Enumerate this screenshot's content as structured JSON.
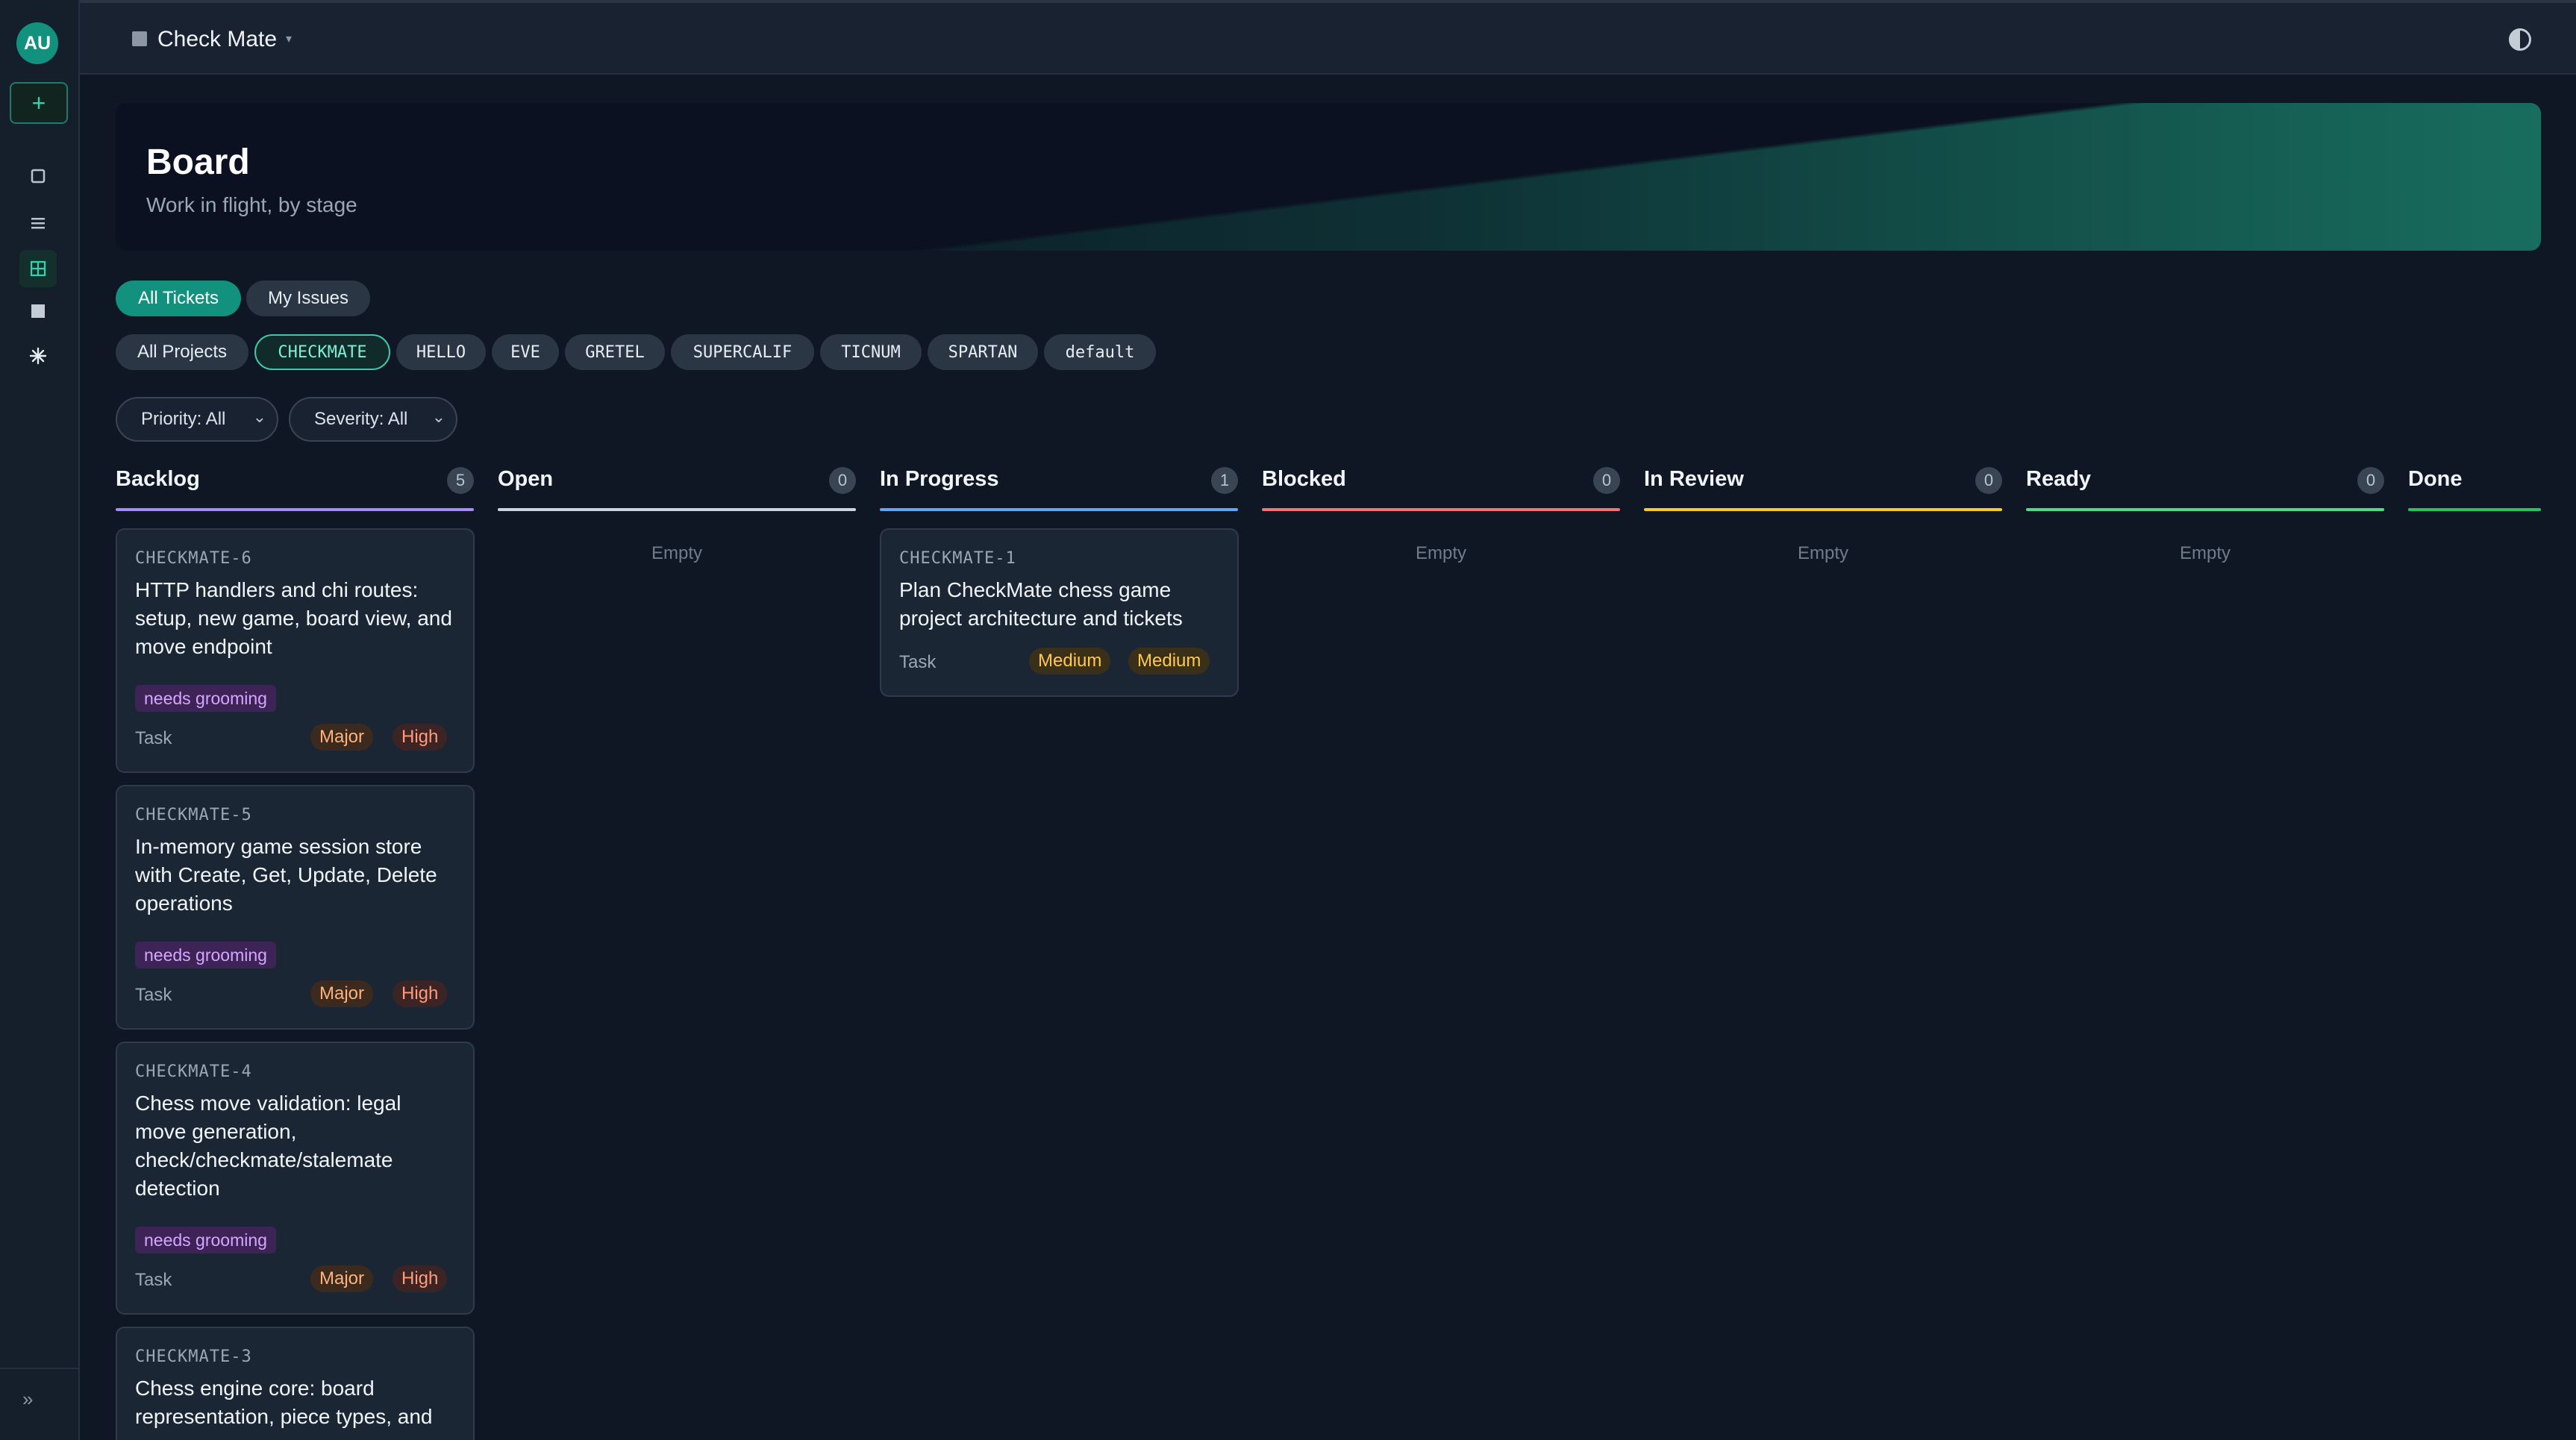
{
  "user": {
    "initials": "AU"
  },
  "sidebar": {
    "new_label": "+",
    "expand_label": "»"
  },
  "topbar": {
    "project_name": "Check Mate",
    "caret": "▾"
  },
  "banner": {
    "title": "Board",
    "subtitle": "Work in flight, by stage"
  },
  "view_tabs": [
    {
      "label": "All Tickets",
      "active": true
    },
    {
      "label": "My Issues",
      "active": false
    }
  ],
  "projects": [
    {
      "label": "All Projects"
    },
    {
      "label": "CHECKMATE",
      "selected": true
    },
    {
      "label": "HELLO"
    },
    {
      "label": "EVE"
    },
    {
      "label": "GRETEL"
    },
    {
      "label": "SUPERCALIF"
    },
    {
      "label": "TICNUM"
    },
    {
      "label": "SPARTAN"
    },
    {
      "label": "default"
    }
  ],
  "filters": {
    "priority": {
      "label": "Priority: All"
    },
    "severity": {
      "label": "Severity: All"
    }
  },
  "columns": [
    {
      "title": "Backlog",
      "count": "5",
      "color": "#a78bfa"
    },
    {
      "title": "Open",
      "count": "0",
      "color": "#cbd5e1",
      "empty": "Empty"
    },
    {
      "title": "In Progress",
      "count": "1",
      "color": "#60a5fa"
    },
    {
      "title": "Blocked",
      "count": "0",
      "color": "#f87171",
      "empty": "Empty"
    },
    {
      "title": "In Review",
      "count": "0",
      "color": "#facc15",
      "empty": "Empty"
    },
    {
      "title": "Ready",
      "count": "0",
      "color": "#4ade80",
      "empty": "Empty"
    },
    {
      "title": "Done",
      "color": "#22c55e"
    }
  ],
  "cards": {
    "backlog": [
      {
        "id": "CHECKMATE-6",
        "title": "HTTP handlers and chi routes: setup, new game, board view, and move endpoint",
        "tag": "needs grooming",
        "type": "Task",
        "severity": "Major",
        "priority": "High"
      },
      {
        "id": "CHECKMATE-5",
        "title": "In-memory game session store with Create, Get, Update, Delete operations",
        "tag": "needs grooming",
        "type": "Task",
        "severity": "Major",
        "priority": "High"
      },
      {
        "id": "CHECKMATE-4",
        "title": "Chess move validation: legal move generation, check/checkmate/stalemate detection",
        "tag": "needs grooming",
        "type": "Task",
        "severity": "Major",
        "priority": "High"
      },
      {
        "id": "CHECKMATE-3",
        "title": "Chess engine core: board representation, piece types, and"
      }
    ],
    "in_progress": [
      {
        "id": "CHECKMATE-1",
        "title": "Plan CheckMate chess game project architecture and tickets",
        "type": "Task",
        "severity": "Medium",
        "priority": "Medium"
      }
    ]
  }
}
